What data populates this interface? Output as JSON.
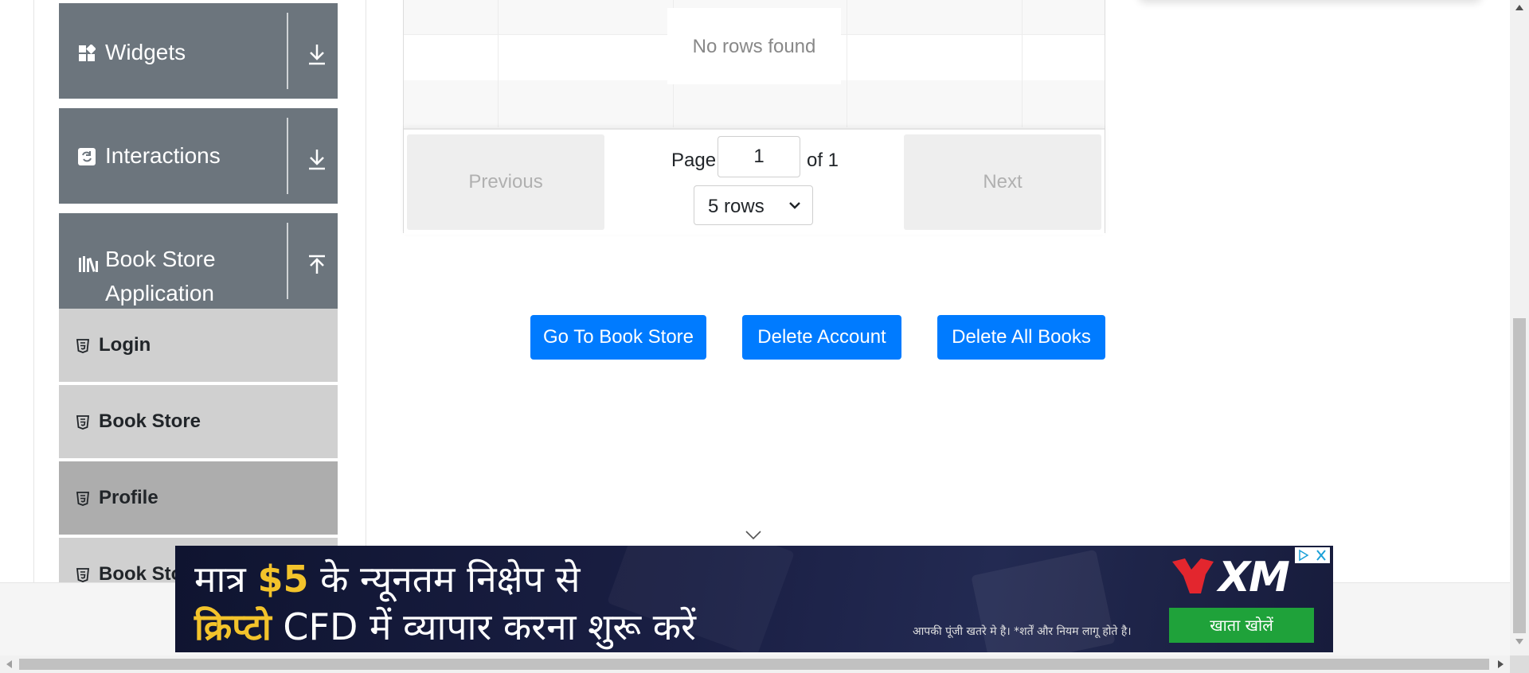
{
  "sidebar": {
    "groups": [
      {
        "label": "Widgets",
        "icon": "widgets-icon",
        "arrow": "download-arrow-icon"
      },
      {
        "label": "Interactions",
        "icon": "interactions-icon",
        "arrow": "download-arrow-icon"
      },
      {
        "label_line1": "Book Store",
        "label_line2": "Application",
        "icon": "books-icon",
        "arrow": "upload-arrow-icon"
      }
    ],
    "items": [
      {
        "label": "Login",
        "icon": "html5-icon"
      },
      {
        "label": "Book Store",
        "icon": "html5-icon"
      },
      {
        "label": "Profile",
        "icon": "html5-icon",
        "active": true
      },
      {
        "label": "Book Store API",
        "icon": "html5-icon"
      }
    ]
  },
  "table": {
    "empty_text": "No rows found",
    "pagination": {
      "previous_label": "Previous",
      "next_label": "Next",
      "page_label": "Page",
      "page_value": "1",
      "of_label": "of 1",
      "rows_select": "5 rows"
    }
  },
  "actions": {
    "go_to_store": "Go To Book Store",
    "delete_account": "Delete Account",
    "delete_all_books": "Delete All Books"
  },
  "ad": {
    "line1_a": "मात्र ",
    "line1_b": "$5",
    "line1_c": " के न्यूनतम निक्षेप से",
    "line2_a": "क्रिप्टो",
    "line2_b": " CFD में  व्यापार करना शुरू करें",
    "disclaimer": "आपकी पूंजी खतरे मे है। *शर्तें और नियम लागू होते है।",
    "brand": "XM",
    "cta": "खाता खोलें"
  },
  "colors": {
    "primary": "#007bff",
    "sidebar_group": "#6c757d",
    "sidebar_item": "#d0d0d0",
    "sidebar_item_active": "#adadad",
    "ad_cta": "#1fa23a"
  }
}
